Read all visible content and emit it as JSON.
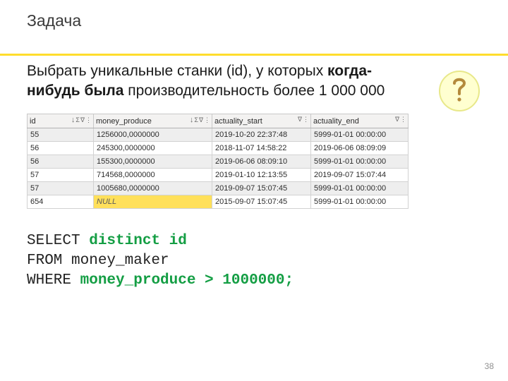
{
  "title": "Задача",
  "task": {
    "line1": "Выбрать уникальные станки (id), у которых ",
    "bold": "когда-нибудь была",
    "line2": " производительность более 1 000 000"
  },
  "icons": {
    "question": "question-icon",
    "sort_down": "↓",
    "sigma": "Σ",
    "funnel": "∇",
    "dots_h": "⋯",
    "dots_v": "⋮"
  },
  "table": {
    "columns": [
      "id",
      "money_produce",
      "actuality_start",
      "actuality_end"
    ],
    "rows": [
      {
        "id": "55",
        "money_produce": "1256000,0000000",
        "actuality_start": "2019-10-20 22:37:48",
        "actuality_end": "5999-01-01 00:00:00"
      },
      {
        "id": "56",
        "money_produce": "245300,0000000",
        "actuality_start": "2018-11-07 14:58:22",
        "actuality_end": "2019-06-06 08:09:09"
      },
      {
        "id": "56",
        "money_produce": "155300,0000000",
        "actuality_start": "2019-06-06 08:09:10",
        "actuality_end": "5999-01-01 00:00:00"
      },
      {
        "id": "57",
        "money_produce": "714568,0000000",
        "actuality_start": "2019-01-10 12:13:55",
        "actuality_end": "2019-09-07 15:07:44"
      },
      {
        "id": "57",
        "money_produce": "1005680,0000000",
        "actuality_start": "2019-09-07 15:07:45",
        "actuality_end": "5999-01-01 00:00:00"
      },
      {
        "id": "654",
        "money_produce": "NULL",
        "actuality_start": "2015-09-07 15:07:45",
        "actuality_end": "5999-01-01 00:00:00"
      }
    ]
  },
  "sql": {
    "select": "SELECT ",
    "distinct_id": "distinct id",
    "from": "FROM money_maker",
    "where_prefix": "WHERE ",
    "where_pred": "money_produce > 1000000;"
  },
  "page_number": "38"
}
